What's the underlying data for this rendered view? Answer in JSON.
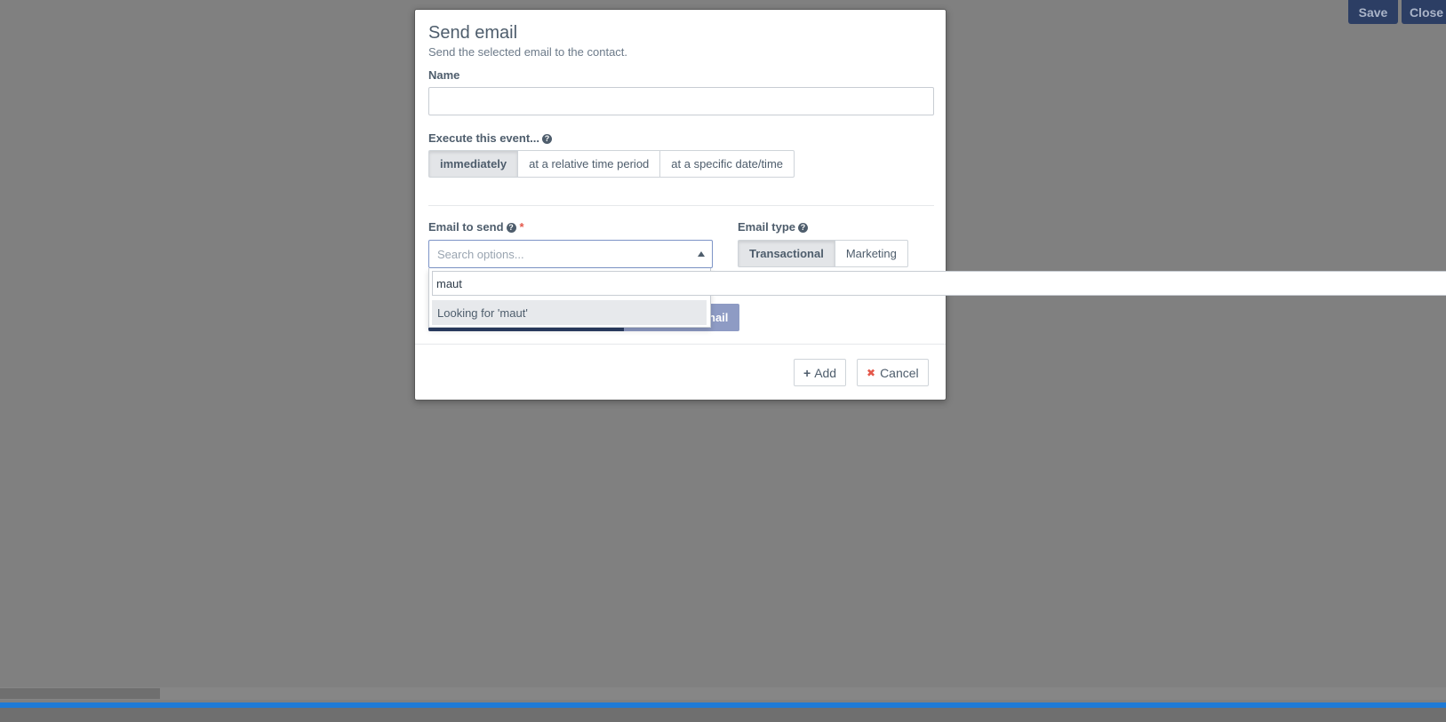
{
  "toolbar": {
    "save_label": "Save",
    "close_label": "Close"
  },
  "modal": {
    "title": "Send email",
    "subtitle": "Send the selected email to the contact.",
    "name_label": "Name",
    "name_value": "",
    "execute_label": "Execute this event...",
    "execute_options": [
      "immediately",
      "at a relative time period",
      "at a specific date/time"
    ],
    "execute_selected": "immediately",
    "email_to_send_label": "Email to send",
    "email_select_placeholder": "Search options...",
    "email_type_label": "Email type",
    "email_type_options": [
      "Transactional",
      "Marketing"
    ],
    "email_type_selected": "Transactional",
    "behind_button_fragment": "nail",
    "add_label": "Add",
    "cancel_label": "Cancel"
  },
  "dropdown": {
    "search_value": "maut",
    "option_label": "Looking for 'maut'"
  },
  "colors": {
    "overlay": "#808080",
    "primary_dark": "#2c3e64",
    "accent_blue": "#1e7ad6",
    "danger": "#e4584b"
  }
}
